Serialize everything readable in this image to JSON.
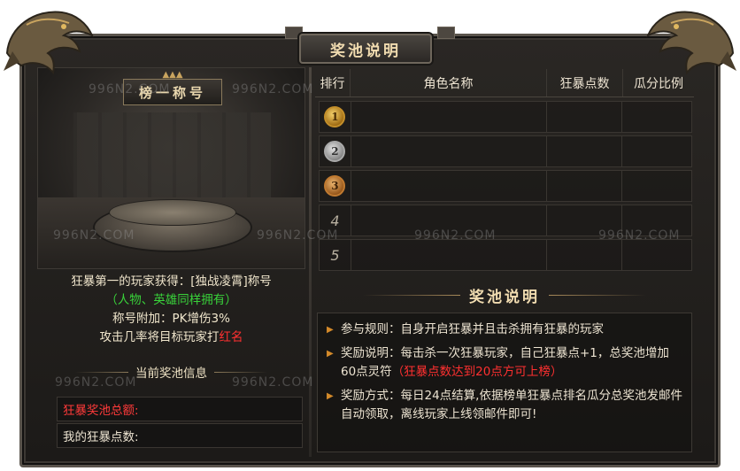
{
  "window": {
    "title": "奖池说明"
  },
  "watermark": "996N2.COM",
  "left": {
    "banner": "榜一称号",
    "reward_line1": "狂暴第一的玩家获得：[独战凌霄]称号",
    "reward_line2": "（人物、英雄同样拥有）",
    "reward_line3": "称号附加：PK增伤3%",
    "reward_line4_prefix": "攻击几率将目标玩家打",
    "reward_line4_red": "红名",
    "pool_info_header": "当前奖池信息",
    "pool_total_label": "狂暴奖池总额:",
    "my_points_label": "我的狂暴点数:"
  },
  "table": {
    "headers": [
      "排行",
      "角色名称",
      "狂暴点数",
      "瓜分比例"
    ],
    "rows": [
      {
        "rank": "1",
        "medal": "gold",
        "name": "",
        "points": "",
        "share": ""
      },
      {
        "rank": "2",
        "medal": "silver",
        "name": "",
        "points": "",
        "share": ""
      },
      {
        "rank": "3",
        "medal": "bronze",
        "name": "",
        "points": "",
        "share": ""
      },
      {
        "rank": "4",
        "medal": "",
        "name": "",
        "points": "",
        "share": ""
      },
      {
        "rank": "5",
        "medal": "",
        "name": "",
        "points": "",
        "share": ""
      }
    ]
  },
  "rules": {
    "title": "奖池说明",
    "rule1": "参与规则：自身开启狂暴并且击杀拥有狂暴的玩家",
    "rule2_main": "奖励说明：每击杀一次狂暴玩家，自己狂暴点+1，总奖池增加60点灵符",
    "rule2_red": "（狂暴点数达到20点方可上榜）",
    "rule3": "奖励方式：每日24点结算,依据榜单狂暴点排名瓜分总奖池发邮件自动领取，离线玩家上线领邮件即可!"
  },
  "colors": {
    "gold": "#f1dcb0",
    "red": "#ff3030",
    "green": "#39d23a",
    "arrow": "#d48a2a"
  }
}
